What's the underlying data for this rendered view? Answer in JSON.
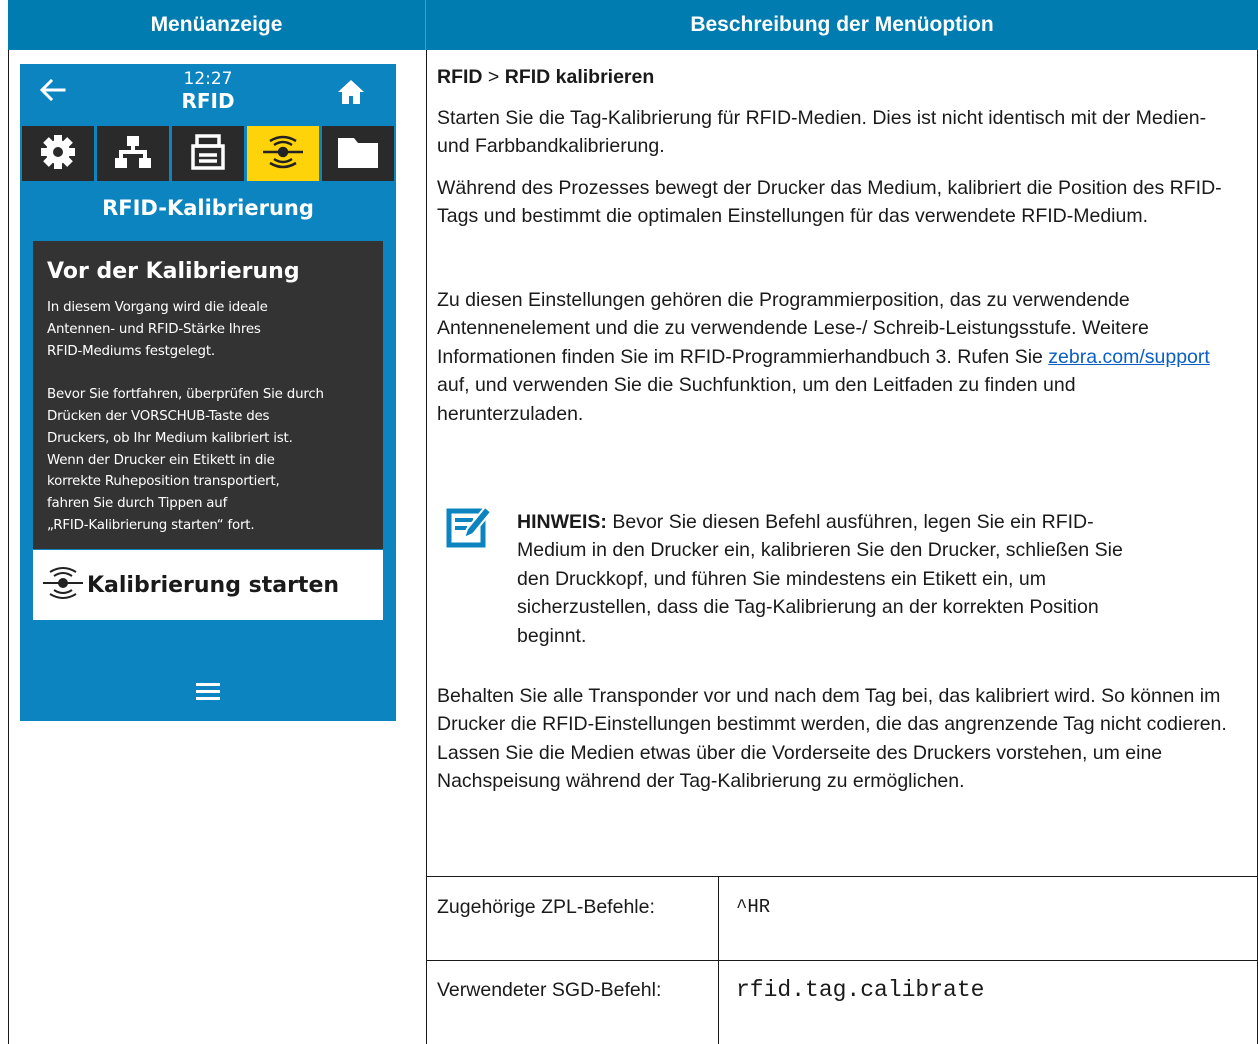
{
  "headers": {
    "left": "Menüanzeige",
    "right": "Beschreibung der Menüoption"
  },
  "device": {
    "time": "12:27",
    "screen_name": "RFID",
    "tabs": [
      {
        "icon": "gear-icon"
      },
      {
        "icon": "network-icon"
      },
      {
        "icon": "printer-icon"
      },
      {
        "icon": "rfid-icon",
        "active": true
      },
      {
        "icon": "folder-icon"
      }
    ],
    "section_title": "RFID-Kalibrierung",
    "info_title": "Vor der Kalibrierung",
    "info_text": "In diesem Vorgang wird die ideale\nAntennen- und RFID-Stärke Ihres\nRFID-Mediums festgelegt.\n\nBevor Sie fortfahren, überprüfen Sie durch\nDrücken der VORSCHUB-Taste des\nDruckers, ob Ihr Medium kalibriert ist.\nWenn der Drucker ein Etikett in die\nkorrekte Ruheposition transportiert,\nfahren Sie durch Tippen auf\n„RFID-Kalibrierung starten“ fort.",
    "start_button": "Kalibrierung starten",
    "colors": {
      "background": "#0b84c0",
      "active_tab": "#ffd30a",
      "box": "#333333"
    }
  },
  "description": {
    "breadcrumb_a": "RFID",
    "breadcrumb_sep": " > ",
    "breadcrumb_b": "RFID kalibrieren",
    "p1": "Starten Sie die Tag-Kalibrierung für RFID-Medien. Dies ist nicht identisch mit der Medien- und Farbbandkalibrierung.",
    "p2": "Während des Prozesses bewegt der Drucker das Medium, kalibriert die Position des RFID-Tags und bestimmt die optimalen Einstellungen für das verwendete RFID-Medium.",
    "p3_before": "Zu diesen Einstellungen gehören die Programmierposition, das zu verwendende Antennenelement und die zu verwendende Lese-/ Schreib-Leistungsstufe. Weitere Informationen finden Sie im RFID-Programmierhandbuch 3. Rufen Sie ",
    "p3_link": "zebra.com/support",
    "p3_after": " auf, und verwenden Sie die Suchfunktion, um den Leitfaden zu finden und herunterzuladen.",
    "note_label": "HINWEIS:",
    "note_text": " Bevor Sie diesen Befehl ausführen, legen Sie ein RFID-Medium in den Drucker ein, kalibrieren Sie den Drucker, schließen Sie den Druckkopf, und führen Sie mindestens ein Etikett ein, um sicherzustellen, dass die Tag-Kalibrierung an der korrekten Position beginnt.",
    "p5": "Behalten Sie alle Transponder vor und nach dem Tag bei, das kalibriert wird. So können im Drucker die RFID-Einstellungen bestimmt werden, die das angrenzende Tag nicht codieren. Lassen Sie die Medien etwas über die Vorderseite des Druckers vorstehen, um eine Nachspeisung während der Tag-Kalibrierung zu ermöglichen."
  },
  "commands": [
    {
      "label": "Zugehörige ZPL-Befehle:",
      "value": "^HR"
    },
    {
      "label": "Verwendeter SGD-Befehl:",
      "value": "rfid.tag.calibrate"
    }
  ]
}
